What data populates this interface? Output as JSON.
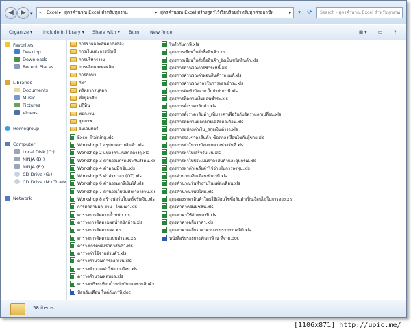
{
  "address": {
    "chevrons": "«",
    "crumbs": [
      "Excel",
      "สูตรคำนวณ Excel สำหรับทุกงาน",
      "สูตรคำนวณ Excel สร้างสูตรไว้เรียบร้อยสำหรับทุกสายอาชีพ"
    ],
    "separator": "▸",
    "dropdown": "▾"
  },
  "search": {
    "placeholder": "Search - สูตรคำนวณ Excel สำหรับทุกงาน"
  },
  "toolbar": {
    "organize": "Organize ▾",
    "include": "Include in library ▾",
    "share": "Share with ▾",
    "burn": "Burn",
    "new_folder": "New folder",
    "views": "▦ ▾",
    "preview": "▭",
    "help": "?"
  },
  "nav": {
    "favorites": "Favorites",
    "desktop": "Desktop",
    "downloads": "Downloads",
    "recent": "Recent Places",
    "libraries": "Libraries",
    "documents": "Documents",
    "music": "Music",
    "pictures": "Pictures",
    "videos": "Videos",
    "homegroup": "Homegroup",
    "computer": "Computer",
    "local_disk": "Local Disk (C:)",
    "ninja_d": "NINJA (D:)",
    "ninja_e": "NINJA (E:)",
    "cd_g": "CD Drive (G:)",
    "cd_n": "CD Drive (N:) TrueM",
    "network": "Network"
  },
  "files": {
    "col1": [
      {
        "name": "การขายและสินค้าคงคลัง",
        "type": "folder"
      },
      {
        "name": "การเงินและการบัญชี",
        "type": "folder"
      },
      {
        "name": "การบริหารงาน",
        "type": "folder"
      },
      {
        "name": "การผลิตและผลผลิต",
        "type": "folder"
      },
      {
        "name": "การศึกษา",
        "type": "folder"
      },
      {
        "name": "กีฬา",
        "type": "folder"
      },
      {
        "name": "ทรัพยากรบุคคล",
        "type": "folder"
      },
      {
        "name": "ที่อยู่อาศัย",
        "type": "folder"
      },
      {
        "name": "ปฏิทิน",
        "type": "folder"
      },
      {
        "name": "พนักงาน",
        "type": "folder"
      },
      {
        "name": "สุขภาพ",
        "type": "folder"
      },
      {
        "name": "อินเวนทอรี่",
        "type": "folder"
      },
      {
        "name": "Excel Training.xls",
        "type": "excel"
      },
      {
        "name": "Workshop 1 สรุปยอดขายสินค้า.xls",
        "type": "excel"
      },
      {
        "name": "Workshop 2 แปลงค่าเงินสกุลต่างๆ.xls",
        "type": "excel"
      },
      {
        "name": "Workshop 3 คำนวณเกรดประกันสังคม.xls",
        "type": "excel"
      },
      {
        "name": "Workshop 4 คำคอมมิชชั่น.xls",
        "type": "excel"
      },
      {
        "name": "Workshop 5 คำล่วงเวลา (OT).xls",
        "type": "excel"
      },
      {
        "name": "Workshop 6 คำนวณภาษีเงินได้.xls",
        "type": "excel"
      },
      {
        "name": "Workshop 7 คำนวณใบบันทึกเวลางาน.xls",
        "type": "excel"
      },
      {
        "name": "Workshop 8 สร้างฟอร์มใบเสร็จรับเงิน.xls",
        "type": "excel"
      },
      {
        "name": "การติดตามผล_งาน_ โฆษณา.xls",
        "type": "excel"
      },
      {
        "name": "ตารางการติดตามน้ำหนัก.xls",
        "type": "excel"
      },
      {
        "name": "ตารางการติดตามผลน้ำหนักอ้วน.xls",
        "type": "excel"
      },
      {
        "name": "ตารางการติดตามผล.xls",
        "type": "excel"
      },
      {
        "name": "ตารางการติดตามแบบสำรวจ.xls",
        "type": "excel"
      },
      {
        "name": "ตารางเกรดของราคาสินค้า.xls",
        "type": "excel"
      },
      {
        "name": "ตารางค่าใช้จ่ายส่วนตัว.xls",
        "type": "excel"
      },
      {
        "name": "ตารางคำนวณการออกเงิน.xls",
        "type": "excel"
      },
      {
        "name": "ตารางคำนวณค่าไฟรายเดือน.xls",
        "type": "excel"
      },
      {
        "name": "ตารางคำนวณผลบอล.xls",
        "type": "excel"
      },
      {
        "name": "ตารางเปรียบเทียบน้ำหนักกับยอดขายสินค้า.xls",
        "type": "excel"
      },
      {
        "name": "ป้อนวันเดือน ไบค์กับภาษี.doc",
        "type": "word"
      }
    ],
    "col2": [
      {
        "name": "ใบกำกับภาษี.xls",
        "type": "excel"
      },
      {
        "name": "สูตรการเขียนใบสั่งซื้อสินค้า.xls",
        "type": "excel"
      },
      {
        "name": "สูตรการเขียนใบสั่งซื้อสินค้า_ยังเป็นชนิดสินค้า.xls",
        "type": "excel"
      },
      {
        "name": "สูตรการคำนวณการชำระหนี้.xls",
        "type": "excel"
      },
      {
        "name": "สูตรการคำนวณค่าผ่อนสินค้ารถยนต์.xls",
        "type": "excel"
      },
      {
        "name": "สูตรการคำนวณเวลาในการผ่อนชำระ.xls",
        "type": "excel"
      },
      {
        "name": "สูตรการจัดทำบิลจาก ใบกำกับภาษี.xls",
        "type": "excel"
      },
      {
        "name": "สูตรการติดตามเงินผ่อนชำระ.xls",
        "type": "excel"
      },
      {
        "name": "สูตรการตั้งราคาสินค้า.xls",
        "type": "excel"
      },
      {
        "name": "สูตรการตั้งราคาสินค้า_เพิ่มราคาเพื่อรับกับอัตราแลกเปลี่ยน.xls",
        "type": "excel"
      },
      {
        "name": "สูตรการติดตามยอดขายเฉลี่ยต่อเดือน.xls",
        "type": "excel"
      },
      {
        "name": "สูตรการแปลงค่าเงิน_สกุลเงินต่างๆ.xls",
        "type": "excel"
      },
      {
        "name": "สูตรการจองราคาสินค้า_ข้อตกลงเงื่อนไขกับผู้ขาย.xls",
        "type": "excel"
      },
      {
        "name": "สูตรการทำใบวางบิลแยกตามช่วงวันที่.xls",
        "type": "excel"
      },
      {
        "name": "สูตรการทำใบเสร็จรับเงิน.xls",
        "type": "excel"
      },
      {
        "name": "สูตรการทำใบประเมินราคาสินค้าและอุปกรณ์.xls",
        "type": "excel"
      },
      {
        "name": "สูตรการหาค่าเฉลี่ยค่าใช้จ่ายในการลงทุน.xls",
        "type": "excel"
      },
      {
        "name": "สูตรคำนวณเงินเดือนหักภาษี.xls",
        "type": "excel"
      },
      {
        "name": "สูตรคำนวณวันทำงานในแต่ละเดือน.xls",
        "type": "excel"
      },
      {
        "name": "สูตรคำนวณวันปีใหม่.xls",
        "type": "excel"
      },
      {
        "name": "สูตรจองราคาสินค้าโดยใช้เงื่อนไขซื้อสินค้าเป็นเงื่อนไขในการจอง.xls",
        "type": "excel"
      },
      {
        "name": "สูตรหาค่าคอมมิชชั่น.xls",
        "type": "excel"
      },
      {
        "name": "สูตรหาค่าใช้จ่ายของปี.xls",
        "type": "excel"
      },
      {
        "name": "สูตรหาค่าเฉลี่ยราคา.xls",
        "type": "excel"
      },
      {
        "name": "สูตรหาค่าเฉลี่ยราคาตามแบบรายงานสถิติ.xls",
        "type": "excel"
      },
      {
        "name": "หนังสือรับรองการหักภาษี ณ ที่จ่าย.doc",
        "type": "word"
      }
    ]
  },
  "status": {
    "item_count": "58 items"
  },
  "watermark": "[1106x871] http://upic.me/",
  "colors": {
    "window_border": "#6b7f9c",
    "accent": "#2b6ebd",
    "excel_green": "#1f8a3a",
    "word_blue": "#2b59b8"
  }
}
